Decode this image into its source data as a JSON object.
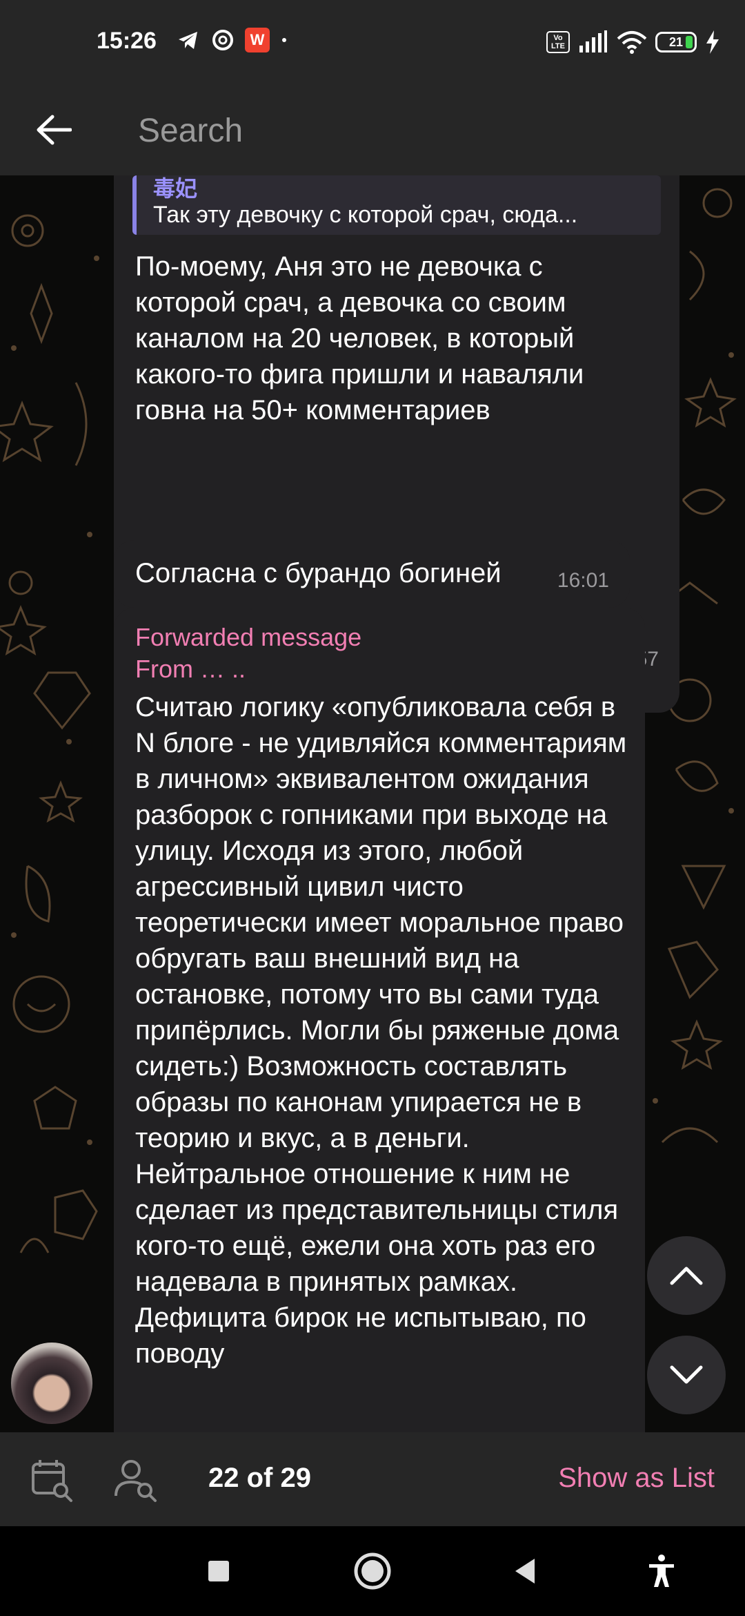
{
  "status_bar": {
    "time": "15:26",
    "battery": "21",
    "signal_label": "Vo LTE",
    "app_badge": "W"
  },
  "header": {
    "search_placeholder": "Search"
  },
  "messages": [
    {
      "reply_name": "毒妃",
      "reply_text": "Так эту девочку с которой срач, сюда...",
      "text": "По-моему, Аня это не девочка с которой срач, а девочка со своим каналом на 20 человек, в который какого-то фига пришли и наваляли говна на 50+ комментариев",
      "reaction": "❤",
      "time": "15:57"
    },
    {
      "text": "Согласна с бурандо богиней",
      "time": "16:01"
    },
    {
      "forwarded_label": "Forwarded message",
      "from_label": "From … ..",
      "text": "Считаю логику «опубликовала себя в N блоге - не удивляйся комментариям в личном» эквивалентом ожидания разборок с гопниками при выходе на улицу. Исходя из этого, любой агрессивный цивил чисто теоретически имеет моральное право обругать ваш внешний вид на остановке, потому что вы сами туда припёрлись. Могли бы ряженые дома сидеть:) Возможность составлять образы по канонам упирается не в теорию и вкус, а в деньги. Нейтральное отношение к ним не сделает из представительницы стиля кого-то ещё, ежели она хоть раз его надевала в принятых рамках. Дефицита бирок не испытываю, по поводу"
    }
  ],
  "bottom_bar": {
    "counter": "22 of 29",
    "show_as_list": "Show as List"
  },
  "colors": {
    "bar_bg": "#262626",
    "bubble_bg": "#222123",
    "accent_pink": "#f27fb3",
    "reply_accent": "#8a83e6",
    "heart": "#e8242c"
  },
  "icons": [
    "back-arrow-icon",
    "telegram-icon",
    "sync-icon",
    "wps-icon",
    "signal-icon",
    "wifi-icon",
    "battery-icon",
    "charging-icon",
    "calendar-search-icon",
    "user-search-icon",
    "chevron-up-icon",
    "chevron-down-icon",
    "recents-icon",
    "home-icon",
    "back-icon",
    "accessibility-icon"
  ]
}
